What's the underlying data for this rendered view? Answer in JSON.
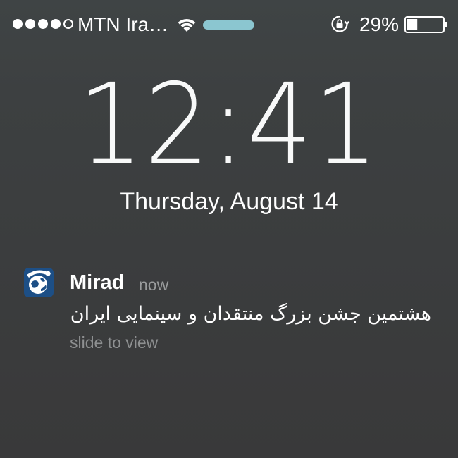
{
  "status_bar": {
    "signal_bars": [
      true,
      true,
      true,
      true,
      false
    ],
    "carrier": "MTN Ira…",
    "wifi_icon": "wifi-icon",
    "activity_color": "#8bc6d0",
    "rotation_lock_icon": "rotation-lock-icon",
    "battery_percent": "29%",
    "battery_level": 0.29,
    "battery_icon": "battery-icon"
  },
  "lock_screen": {
    "time": "12:41",
    "date": "Thursday, August 14"
  },
  "notification": {
    "app_icon": "mirad-app-icon",
    "app_name": "Mirad",
    "time_ago": "now",
    "message": "هشتمین جشن بزرگ منتقدان و سینمایی ایران",
    "action_hint": "slide to view"
  },
  "colors": {
    "background": "#3c3f40",
    "text": "#ffffff",
    "secondary_text": "#9a9c9d",
    "app_icon_blue": "#1d4f86"
  }
}
